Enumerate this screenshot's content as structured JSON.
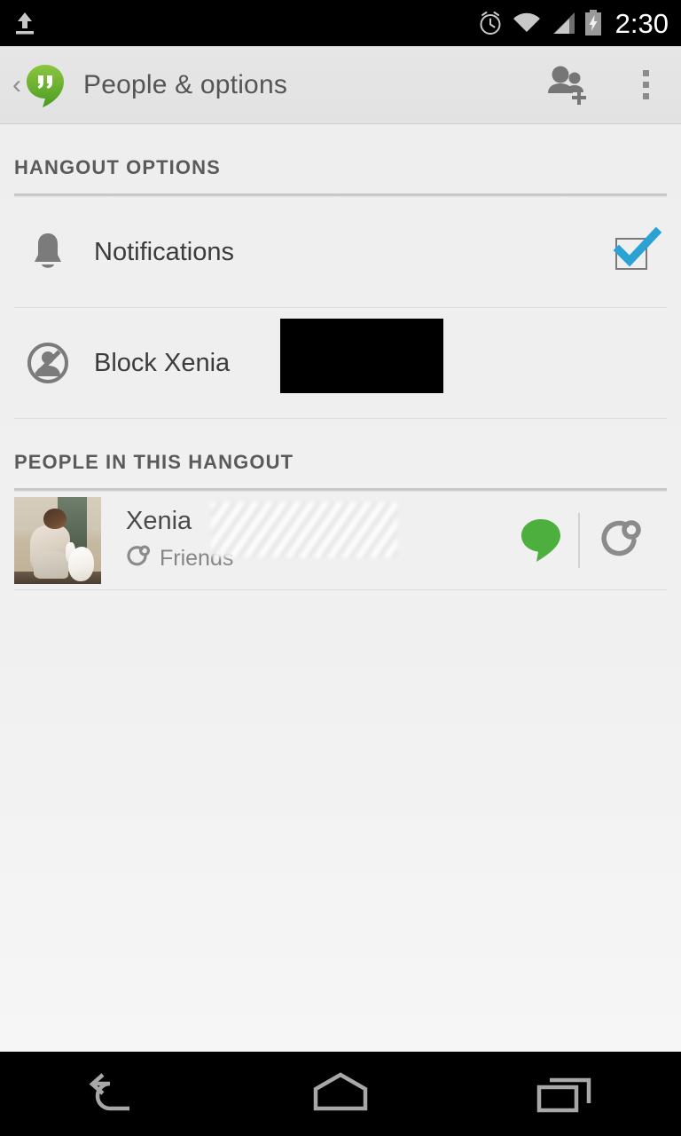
{
  "status_bar": {
    "upload_icon": "upload-icon",
    "alarm_icon": "alarm-clock-icon",
    "wifi_icon": "wifi-icon",
    "signal_icon": "cellular-signal-icon",
    "battery_icon": "battery-charging-icon",
    "clock": "2:30",
    "background": "#000000",
    "icon_color": "#c8c8c8"
  },
  "action_bar": {
    "up_caret": "‹",
    "app_icon": "hangouts-logo-icon",
    "title": "People & options",
    "add_people_icon": "add-people-icon",
    "overflow_icon": "overflow-menu-icon",
    "background": "#e4e4e4",
    "title_color": "#555555"
  },
  "sections": [
    {
      "header": "HANGOUT OPTIONS",
      "rows": [
        {
          "icon": "bell-icon",
          "label": "Notifications",
          "control": "checkbox",
          "checked": true,
          "check_color": "#2aa3d4"
        },
        {
          "icon": "block-icon",
          "label": "Block Xenia",
          "control": "redaction",
          "redacted": true,
          "redaction_color": "#000000"
        }
      ]
    },
    {
      "header": "PEOPLE IN THIS HANGOUT",
      "people": [
        {
          "avatar": "avatar-photo-xenia",
          "name": "Xenia",
          "name_redacted": true,
          "circle_icon": "circles-icon",
          "circle_label": "Friends",
          "presence": "active",
          "presence_color": "#4caf3e",
          "presence_icon": "green-bubble-status-icon",
          "action_icon": "circles-action-icon"
        }
      ]
    }
  ],
  "nav_bar": {
    "back": "back-icon",
    "home": "home-icon",
    "recents": "recents-icon",
    "background": "#000000",
    "icon_color": "#a8a8a8"
  }
}
